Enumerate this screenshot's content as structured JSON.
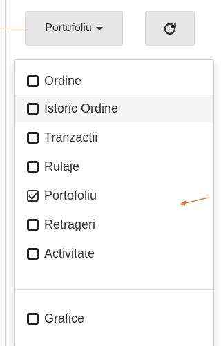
{
  "toolbar": {
    "portfolio_button_label": "Portofoliu",
    "refresh_icon": "refresh-icon"
  },
  "menu": {
    "items": [
      {
        "label": "Ordine",
        "checked": false
      },
      {
        "label": "Istoric Ordine",
        "checked": false
      },
      {
        "label": "Tranzactii",
        "checked": false
      },
      {
        "label": "Rulaje",
        "checked": false
      },
      {
        "label": "Portofoliu",
        "checked": true
      },
      {
        "label": "Retrageri",
        "checked": false
      },
      {
        "label": "Activitate",
        "checked": false
      }
    ],
    "extra_items": [
      {
        "label": "Grafice",
        "checked": false
      }
    ]
  },
  "colors": {
    "annotation": "#e07b39",
    "button_bg": "#e6e6e6",
    "hover_bg": "#f5f5f5"
  }
}
